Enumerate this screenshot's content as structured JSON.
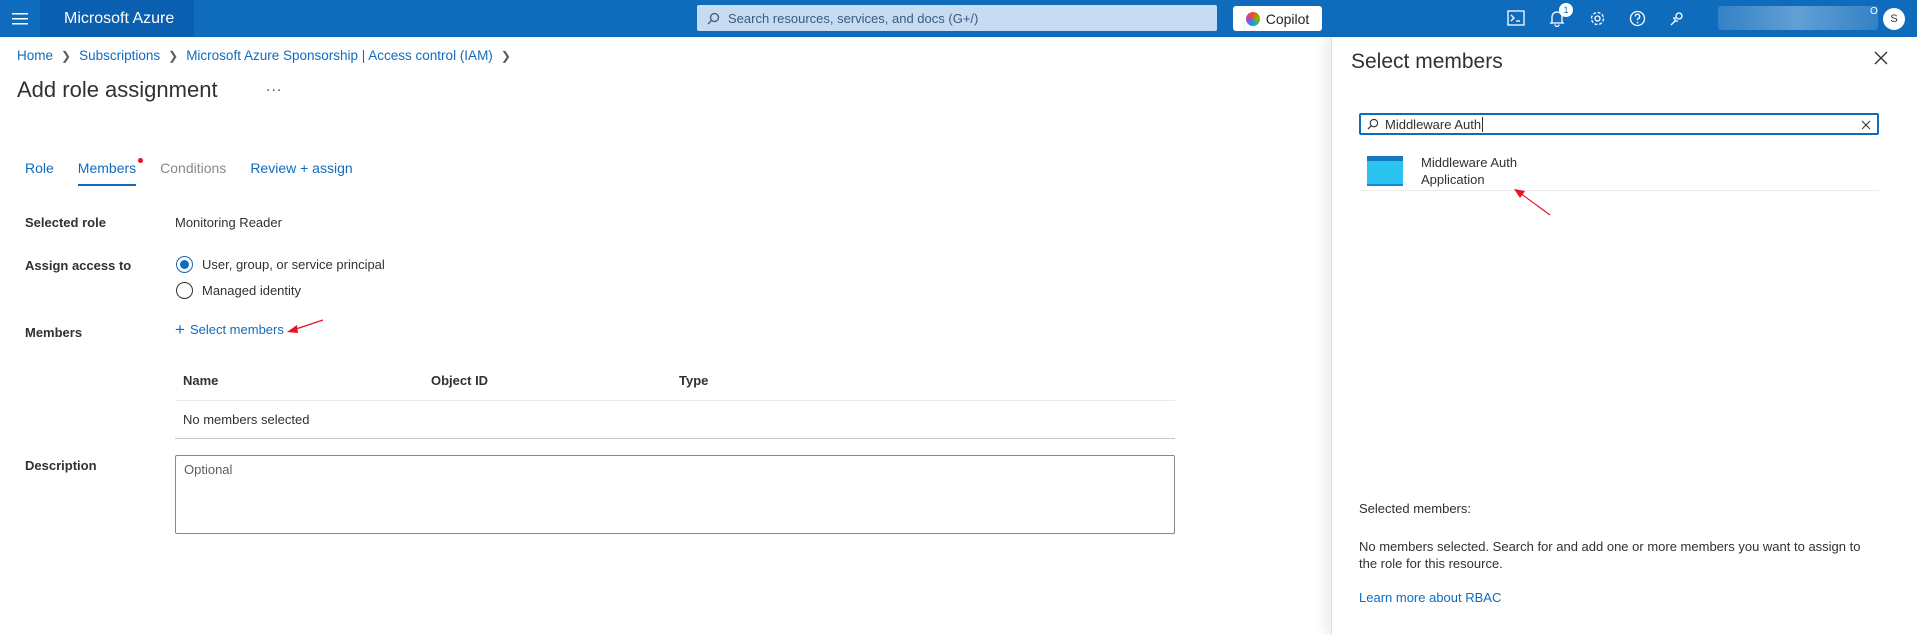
{
  "topbar": {
    "brand": "Microsoft Azure",
    "search_placeholder": "Search resources, services, and docs (G+/)",
    "copilot_label": "Copilot",
    "notification_count": "1",
    "account_initial": "S",
    "account_partial": "O"
  },
  "breadcrumb": [
    "Home",
    "Subscriptions",
    "Microsoft Azure Sponsorship | Access control (IAM)"
  ],
  "page": {
    "title": "Add role assignment",
    "more": "..."
  },
  "tabs": [
    {
      "label": "Role",
      "state": "link"
    },
    {
      "label": "Members",
      "state": "active"
    },
    {
      "label": "Conditions",
      "state": "disabled"
    },
    {
      "label": "Review + assign",
      "state": "link"
    }
  ],
  "form": {
    "selected_role_label": "Selected role",
    "selected_role_value": "Monitoring Reader",
    "assign_access_label": "Assign access to",
    "options": [
      {
        "label": "User, group, or service principal",
        "checked": true
      },
      {
        "label": "Managed identity",
        "checked": false
      }
    ],
    "members_label": "Members",
    "select_members_link": "Select members",
    "table_headers": [
      "Name",
      "Object ID",
      "Type"
    ],
    "table_empty": "No members selected",
    "description_label": "Description",
    "description_placeholder": "Optional"
  },
  "panel": {
    "title": "Select members",
    "search_value": "Middleware Auth",
    "results": [
      {
        "name": "Middleware Auth",
        "type": "Application"
      }
    ],
    "selected_members_label": "Selected members:",
    "empty_message": "No members selected. Search for and add one or more members you want to assign to the role for this resource.",
    "learn_more": "Learn more about RBAC"
  },
  "colors": {
    "topbar": "#0f6cbd",
    "link": "#0f6cbd",
    "annotation_arrow": "#e81123"
  }
}
